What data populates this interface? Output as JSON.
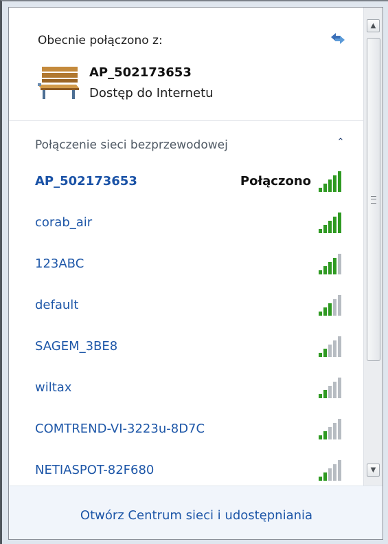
{
  "current": {
    "label": "Obecnie połączono z:",
    "network_name": "AP_502173653",
    "status": "Dostęp do Internetu"
  },
  "section": {
    "title": "Połączenie sieci bezprzewodowej",
    "collapse_glyph": "⌃"
  },
  "networks": [
    {
      "name": "AP_502173653",
      "state": "Połączono",
      "signal_bars": 5
    },
    {
      "name": "corab_air",
      "state": "",
      "signal_bars": 5
    },
    {
      "name": "123ABC",
      "state": "",
      "signal_bars": 4
    },
    {
      "name": "default",
      "state": "",
      "signal_bars": 3
    },
    {
      "name": "SAGEM_3BE8",
      "state": "",
      "signal_bars": 2
    },
    {
      "name": "wiltax",
      "state": "",
      "signal_bars": 2
    },
    {
      "name": "COMTREND-VI-3223u-8D7C",
      "state": "",
      "signal_bars": 2
    },
    {
      "name": "NETIASPOT-82F680",
      "state": "",
      "signal_bars": 2
    }
  ],
  "footer": {
    "link": "Otwórz Centrum sieci i udostępniania"
  },
  "colors": {
    "link": "#1e57a8",
    "signal_on": "#2f9a22",
    "signal_off": "#b7bcc2"
  }
}
